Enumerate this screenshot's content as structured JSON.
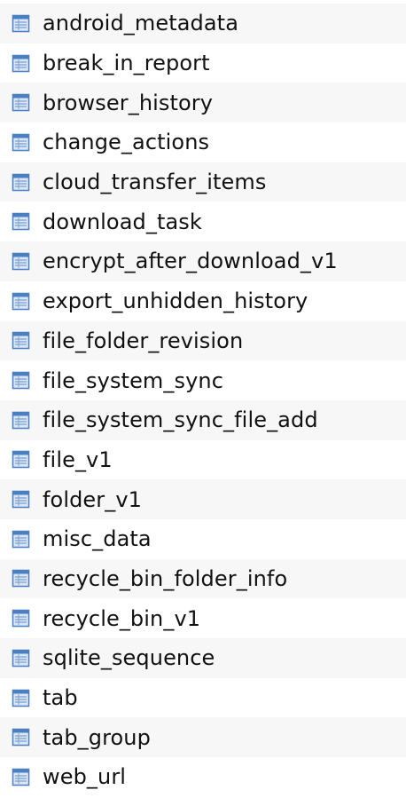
{
  "icon": "table-icon",
  "colors": {
    "icon_border": "#4a7fc1",
    "icon_fill": "#dbe7f5",
    "icon_lines": "#7da3d3",
    "row_alt": "#f7f7f7",
    "text": "#111111"
  },
  "tables": [
    {
      "label": "android_metadata"
    },
    {
      "label": "break_in_report"
    },
    {
      "label": "browser_history"
    },
    {
      "label": "change_actions"
    },
    {
      "label": "cloud_transfer_items"
    },
    {
      "label": "download_task"
    },
    {
      "label": "encrypt_after_download_v1"
    },
    {
      "label": "export_unhidden_history"
    },
    {
      "label": "file_folder_revision"
    },
    {
      "label": "file_system_sync"
    },
    {
      "label": "file_system_sync_file_add"
    },
    {
      "label": "file_v1"
    },
    {
      "label": "folder_v1"
    },
    {
      "label": "misc_data"
    },
    {
      "label": "recycle_bin_folder_info"
    },
    {
      "label": "recycle_bin_v1"
    },
    {
      "label": "sqlite_sequence"
    },
    {
      "label": "tab"
    },
    {
      "label": "tab_group"
    },
    {
      "label": "web_url"
    }
  ]
}
